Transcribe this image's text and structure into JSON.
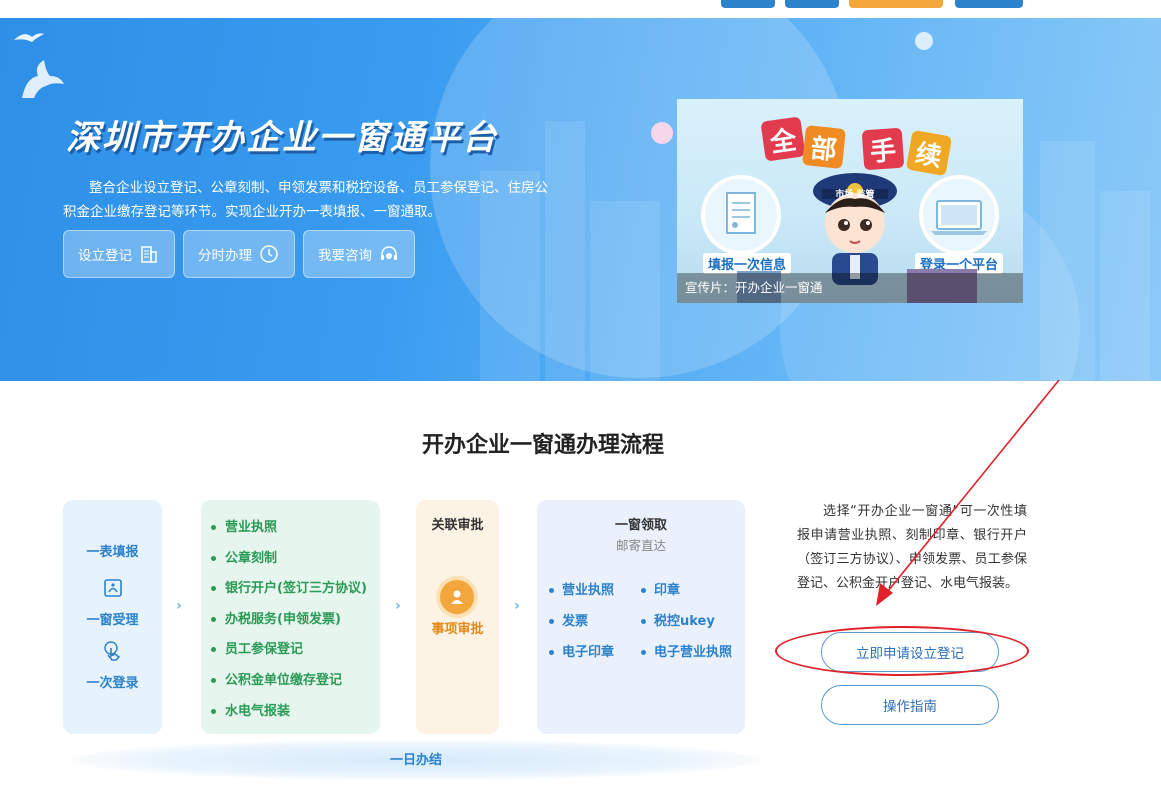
{
  "hero": {
    "title": "深圳市开办企业一窗通平台",
    "description": "整合企业设立登记、公章刻制、申领发票和税控设备、员工参保登记、住房公积金企业缴存登记等环节。实现企业开办一表填报、一窗通取。",
    "buttons": [
      {
        "label": "设立登记",
        "icon": "building-icon"
      },
      {
        "label": "分时办理",
        "icon": "clock-icon"
      },
      {
        "label": "我要咨询",
        "icon": "headset-icon"
      }
    ],
    "promo": {
      "chips": [
        "全",
        "部",
        "手",
        "续"
      ],
      "left_tag": "填报一次信息",
      "right_tag": "登录一个平台",
      "badge_text": "市场 监管",
      "caption": "宣传片：开办企业一窗通"
    }
  },
  "section": {
    "title": "开办企业一窗通办理流程"
  },
  "flow": {
    "step1": {
      "items": [
        "一表填报",
        "一窗受理",
        "一次登录"
      ]
    },
    "step2": {
      "items": [
        "营业执照",
        "公章刻制",
        "银行开户(签订三方协议)",
        "办税服务(申领发票)",
        "员工参保登记",
        "公积金单位缴存登记",
        "水电气报装"
      ]
    },
    "step3": {
      "title": "关联审批",
      "label": "事项审批"
    },
    "step4": {
      "title": "一窗领取",
      "subtitle": "邮寄直达",
      "items": [
        "营业执照",
        "印章",
        "发票",
        "税控ukey",
        "电子印章",
        "电子营业执照"
      ]
    },
    "footer": "一日办结"
  },
  "side": {
    "info": "选择“开办企业一窗通”可一次性填报申请营业执照、刻制印章、银行开户（签订三方协议）、申领发票、员工参保登记、公积金开户登记、水电气报装。",
    "apply_button": "立即申请设立登记",
    "guide_button": "操作指南"
  },
  "colors": {
    "hero_blue": "#2d8fe6",
    "accent_green": "#2a9a55",
    "accent_orange": "#e38a16",
    "accent_blue": "#2d82cc",
    "annotation_red": "#e0212a"
  }
}
